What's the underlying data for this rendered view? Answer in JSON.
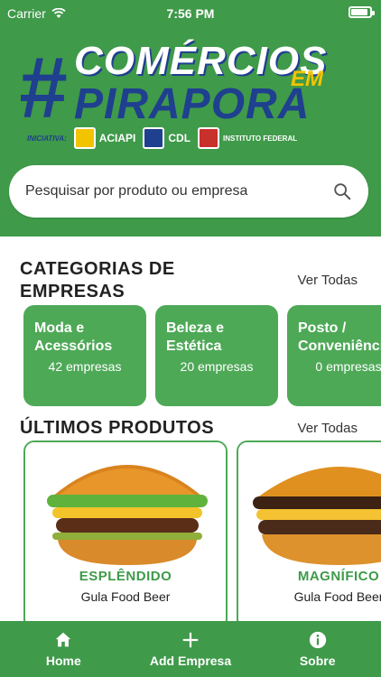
{
  "status_bar": {
    "carrier": "Carrier",
    "time": "7:56 PM"
  },
  "banner": {
    "hash": "#",
    "line1": "COMÉRCIOS",
    "line2": "PIRAPORA",
    "em": "EM",
    "initiative_label": "INICIATIVA:",
    "partners": [
      "ACIAPI",
      "CDL",
      "INSTITUTO FEDERAL"
    ]
  },
  "search": {
    "placeholder": "Pesquisar por produto ou empresa"
  },
  "categories": {
    "title_line1": "CATEGORIAS DE",
    "title_line2": "EMPRESAS",
    "see_all": "Ver Todas",
    "items": [
      {
        "name_line1": "Moda e",
        "name_line2": "Acessórios",
        "count": "42 empresas"
      },
      {
        "name_line1": "Beleza e",
        "name_line2": "Estética",
        "count": "20 empresas"
      },
      {
        "name_line1": "Posto /",
        "name_line2": "Conveniência",
        "count": "0 empresas"
      }
    ]
  },
  "products": {
    "title": "ÚLTIMOS PRODUTOS",
    "see_all": "Ver Todas",
    "items": [
      {
        "name": "ESPLÊNDIDO",
        "company": "Gula Food Beer"
      },
      {
        "name": "MAGNÍFICO",
        "company": "Gula Food Beer"
      }
    ]
  },
  "tab_bar": {
    "home": "Home",
    "add_company": "Add Empresa",
    "about": "Sobre"
  },
  "colors": {
    "primary_green": "#3f9a4a",
    "card_green": "#4ea957",
    "navy": "#1f3f8f",
    "yellow": "#f2c400"
  }
}
